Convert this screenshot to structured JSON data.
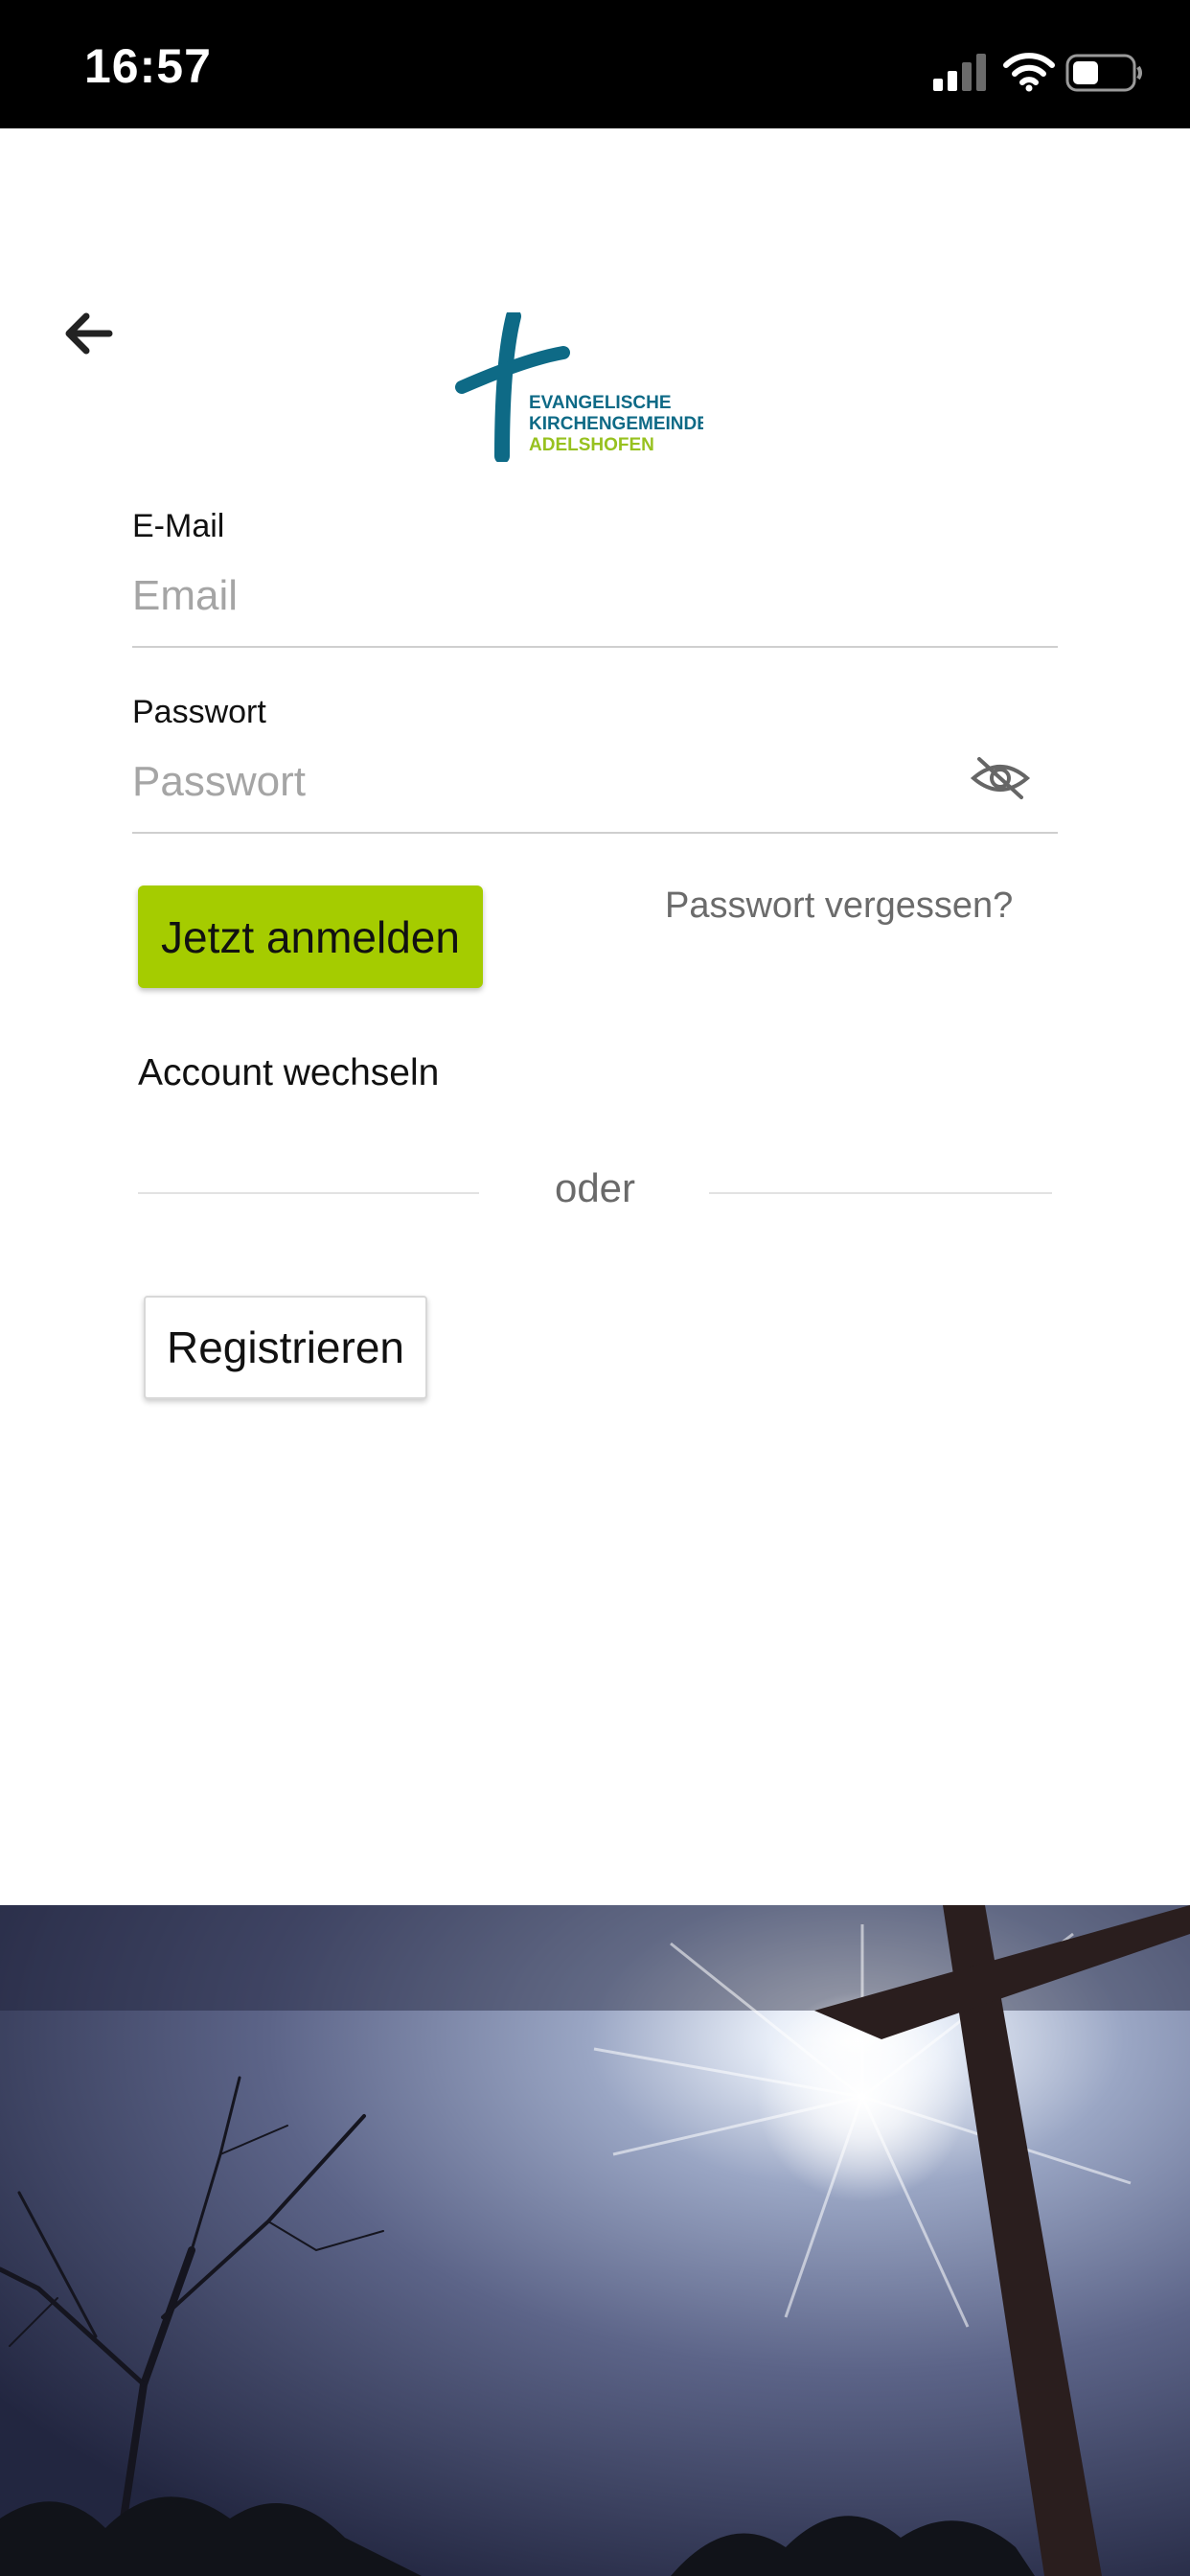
{
  "status_bar": {
    "time": "16:57",
    "signal_icon": "signal-icon",
    "wifi_icon": "wifi-icon",
    "battery_icon": "battery-icon"
  },
  "header": {
    "back_icon": "arrow-left-icon",
    "logo": {
      "line1": "EVANGELISCHE",
      "line2": "KIRCHENGEMEINDE",
      "line3": "ADELSHOFEN",
      "cross_color": "#0e6a86",
      "accent_color": "#97c11f"
    }
  },
  "form": {
    "email": {
      "label": "E-Mail",
      "placeholder": "Email",
      "value": ""
    },
    "password": {
      "label": "Passwort",
      "placeholder": "Passwort",
      "value": "",
      "toggle_icon": "eye-off-icon"
    },
    "login_button": "Jetzt anmelden",
    "forgot_link": "Passwort vergessen?",
    "switch_account": "Account wechseln",
    "divider_text": "oder",
    "register_button": "Registrieren"
  },
  "colors": {
    "primary": "#a5cc00",
    "logo_blue": "#0e6a86"
  }
}
